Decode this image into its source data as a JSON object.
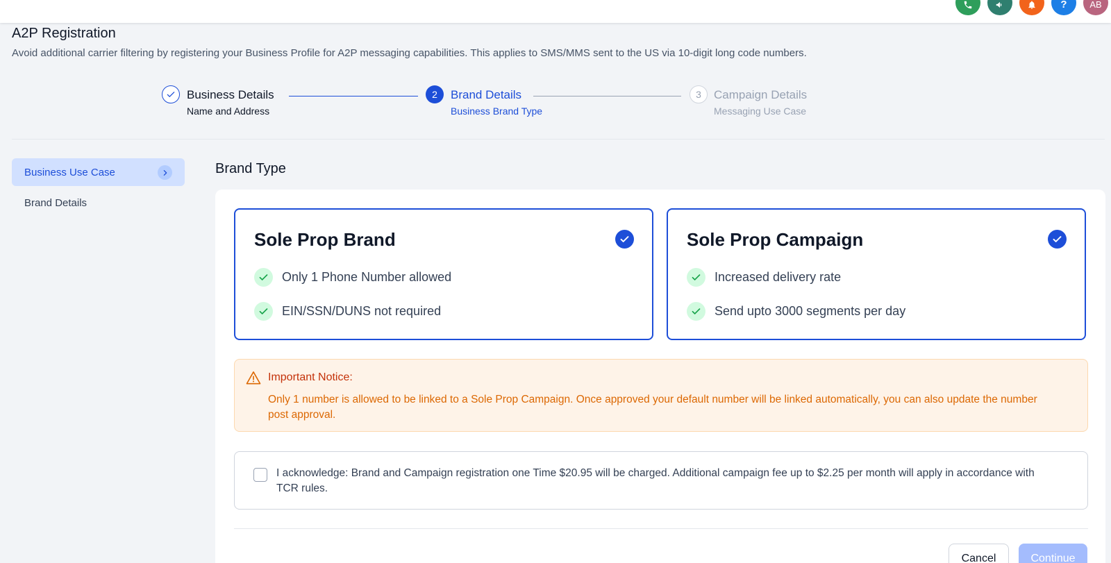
{
  "topbar": {
    "icons": [
      {
        "name": "phone-icon",
        "glyph": "☎",
        "color": "#2e9e5b"
      },
      {
        "name": "megaphone-icon",
        "glyph": "❝",
        "color": "#2f7f6f"
      },
      {
        "name": "bell-icon",
        "glyph": "▲",
        "color": "#f2631b"
      },
      {
        "name": "help-icon",
        "glyph": "?",
        "color": "#1d7fe6"
      }
    ],
    "avatar_initials": "AB",
    "avatar_color": "#b9657f"
  },
  "header": {
    "title": "A2P Registration",
    "description": "Avoid additional carrier filtering by registering your Business Profile for A2P messaging capabilities. This applies to SMS/MMS sent to the US via 10-digit long code numbers."
  },
  "stepper": {
    "steps": [
      {
        "number": "1",
        "title": "Business Details",
        "subtitle": "Name and Address",
        "state": "completed"
      },
      {
        "number": "2",
        "title": "Brand Details",
        "subtitle": "Business Brand Type",
        "state": "active"
      },
      {
        "number": "3",
        "title": "Campaign Details",
        "subtitle": "Messaging Use Case",
        "state": "upcoming"
      }
    ]
  },
  "sidebar": {
    "items": [
      {
        "label": "Business Use Case",
        "active": true
      },
      {
        "label": "Brand Details",
        "active": false
      }
    ]
  },
  "main": {
    "section_title": "Brand Type",
    "cards": [
      {
        "title": "Sole Prop Brand",
        "selected": true,
        "features": [
          "Only 1 Phone Number allowed",
          "EIN/SSN/DUNS not required"
        ]
      },
      {
        "title": "Sole Prop Campaign",
        "selected": true,
        "features": [
          "Increased delivery rate",
          "Send upto 3000 segments per day"
        ]
      }
    ],
    "notice": {
      "title": "Important Notice:",
      "body": "Only 1 number is allowed to be linked to a Sole Prop Campaign. Once approved your default number will be linked automatically, you can also update the number post approval."
    },
    "acknowledge": {
      "checked": false,
      "text": "I acknowledge: Brand and Campaign registration one Time $20.95 will be charged. Additional campaign fee up to $2.25 per month will apply in accordance with TCR rules."
    },
    "buttons": {
      "cancel_label": "Cancel",
      "continue_label": "Continue"
    }
  },
  "colors": {
    "accent": "#1d4ed8",
    "success_bg": "#d1fadf",
    "success": "#16a34a",
    "warning_bg": "#fef3e8",
    "warning_text": "#dc6803"
  }
}
